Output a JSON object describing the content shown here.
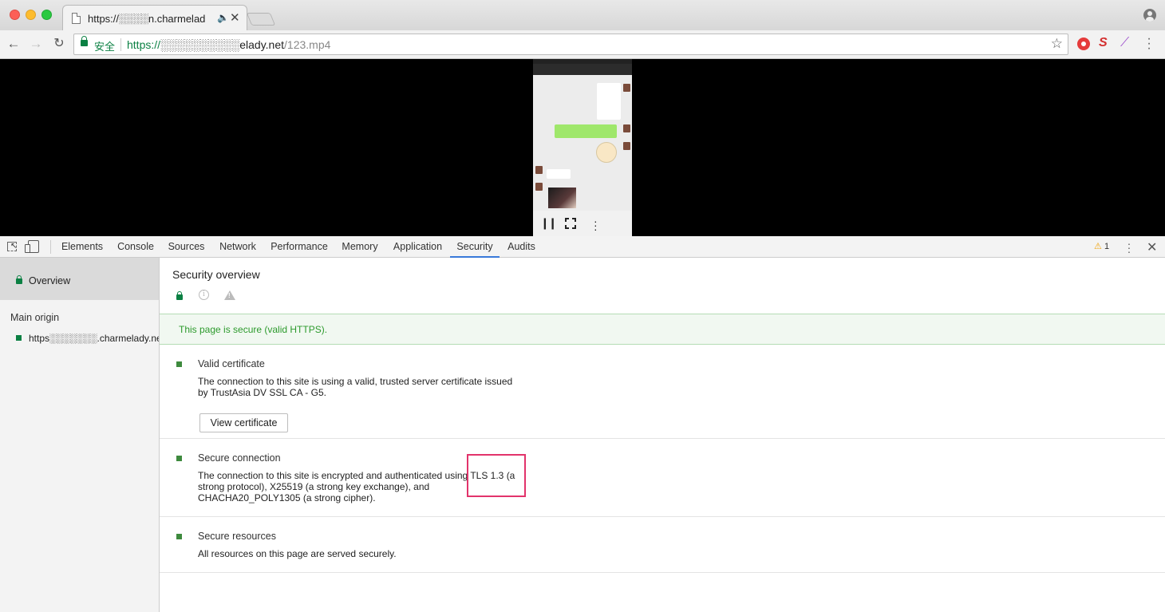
{
  "browser": {
    "tab": {
      "title": "https://░░░░n.charmelad",
      "audio_icon": "speaker-icon",
      "close": "✕"
    },
    "omnibox": {
      "secure_label": "安全",
      "url_scheme": "https://",
      "url_host": "░░░░░░░░░░elady.net",
      "url_path": "/123.mp4"
    },
    "extensions": [
      "record-icon",
      "s-extension-icon",
      "feather-icon"
    ]
  },
  "video": {
    "controls": [
      "pause-icon",
      "fullscreen-icon",
      "more-icon"
    ]
  },
  "devtools": {
    "tabs": [
      "Elements",
      "Console",
      "Sources",
      "Network",
      "Performance",
      "Memory",
      "Application",
      "Security",
      "Audits"
    ],
    "active_tab": "Security",
    "warning_count": "1",
    "sidebar": {
      "overview": "Overview",
      "main_origin_heading": "Main origin",
      "origin_url": "https░░░░░░░.charmelady.net"
    },
    "main": {
      "title": "Security overview",
      "banner": "This page is secure (valid HTTPS).",
      "sections": [
        {
          "title": "Valid certificate",
          "body": "The connection to this site is using a valid, trusted server certificate issued by TrustAsia DV SSL CA - G5.",
          "button": "View certificate"
        },
        {
          "title": "Secure connection",
          "body": "The connection to this site is encrypted and authenticated using TLS 1.3 (a strong protocol), X25519 (a strong key exchange), and CHACHA20_POLY1305 (a strong cipher)."
        },
        {
          "title": "Secure resources",
          "body": "All resources on this page are served securely."
        }
      ]
    }
  },
  "colors": {
    "secure_green": "#0b8043",
    "banner_text": "#2c9a2c",
    "active_tab_underline": "#3879d9",
    "highlight_box": "#e2336b"
  }
}
